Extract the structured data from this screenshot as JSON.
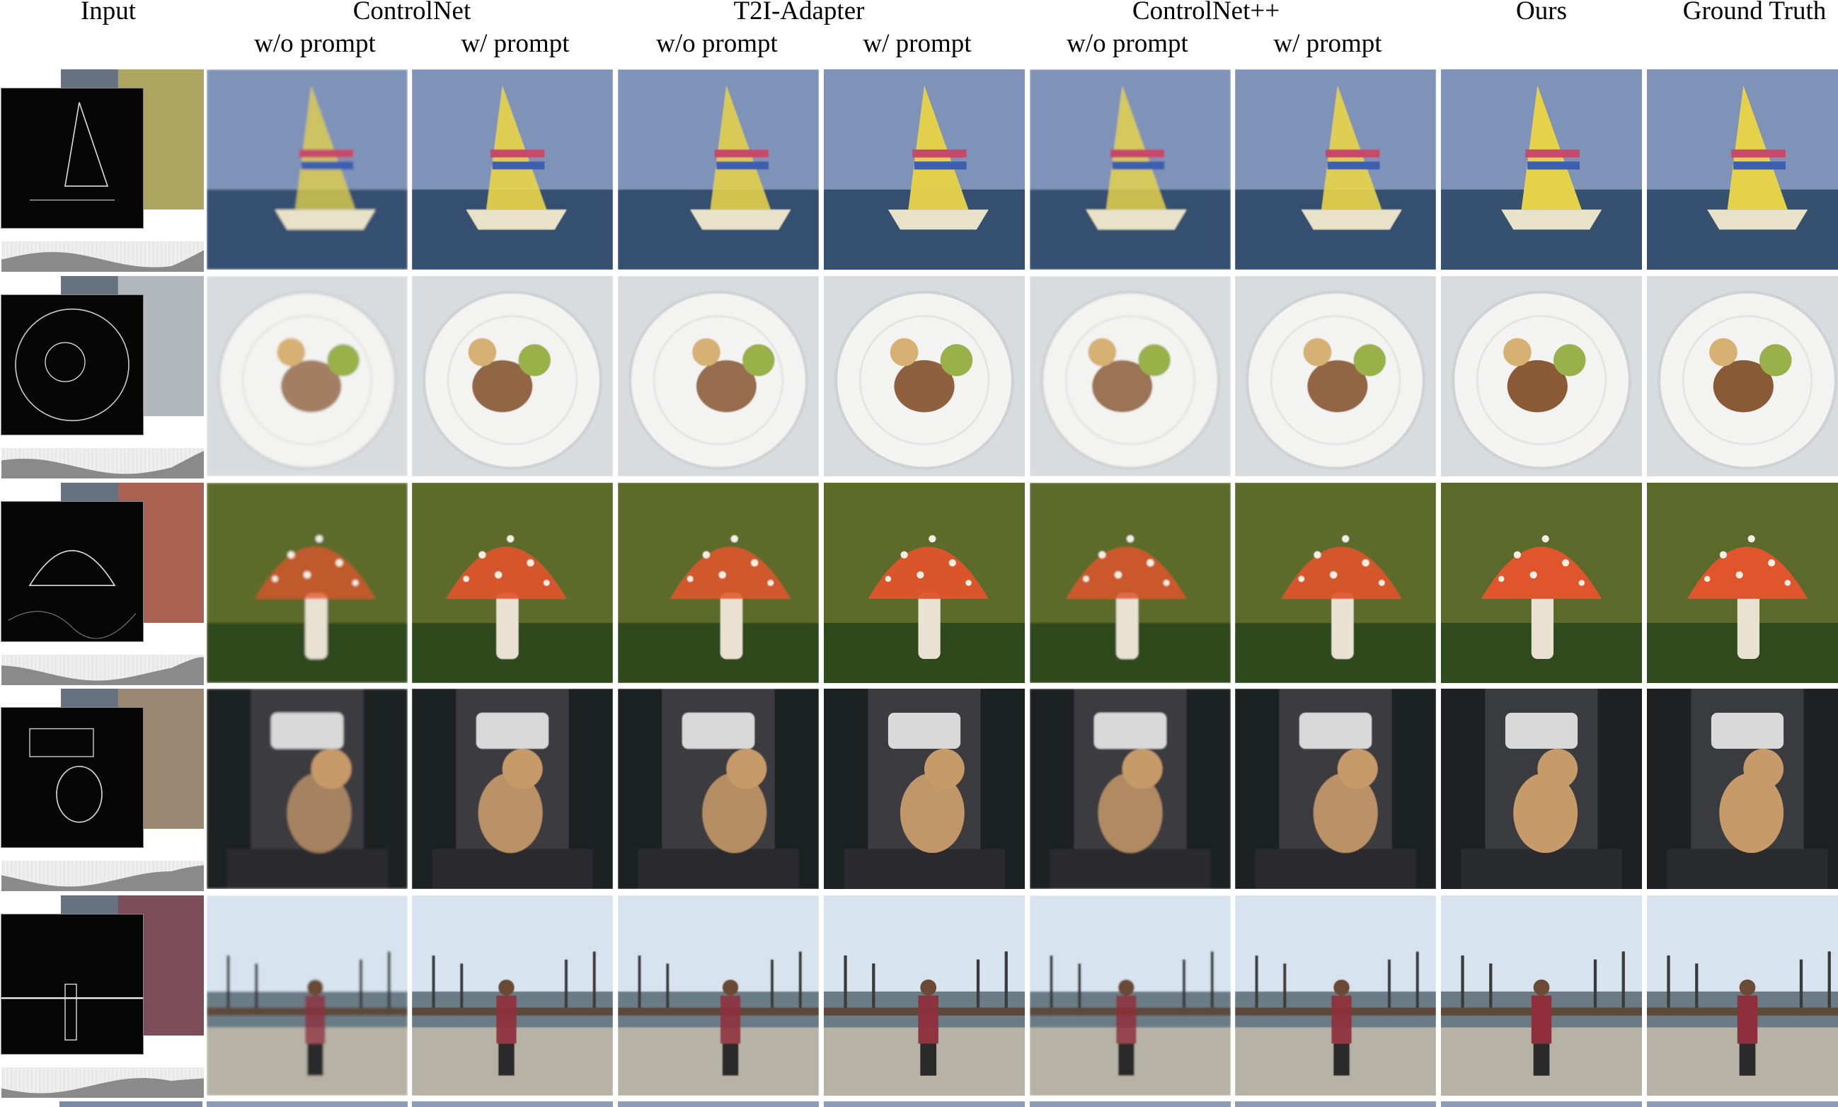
{
  "header": {
    "input": "Input",
    "methods": [
      {
        "name": "ControlNet",
        "subs": [
          "w/o prompt",
          "w/ prompt"
        ]
      },
      {
        "name": "T2I-Adapter",
        "subs": [
          "w/o prompt",
          "w/ prompt"
        ]
      },
      {
        "name": "ControlNet++",
        "subs": [
          "w/o prompt",
          "w/ prompt"
        ]
      }
    ],
    "ours": "Ours",
    "ground_truth": "Ground Truth"
  },
  "rows": [
    {
      "subject": "sailboat",
      "colors": {
        "bg": "#7f93b8",
        "main": "#e6d24a",
        "accent": "#c74a6b",
        "ground": "#36506f"
      }
    },
    {
      "subject": "dinner-plate",
      "colors": {
        "bg": "#d9dcdf",
        "main": "#f3f3f1",
        "accent": "#8a5a36",
        "ground": "#9ab04a"
      }
    },
    {
      "subject": "mushroom",
      "colors": {
        "bg": "#5b6a2a",
        "main": "#e0552c",
        "accent": "#f4efe2",
        "ground": "#2f4a1c"
      }
    },
    {
      "subject": "dog-in-car",
      "colors": {
        "bg": "#3a3b3f",
        "main": "#c79a6a",
        "accent": "#d9d9d9",
        "ground": "#1f2024"
      }
    },
    {
      "subject": "woman-on-pier",
      "colors": {
        "bg": "#d7e3ee",
        "main": "#8f2f3c",
        "accent": "#5c4a3a",
        "ground": "#6b7b86"
      }
    }
  ]
}
